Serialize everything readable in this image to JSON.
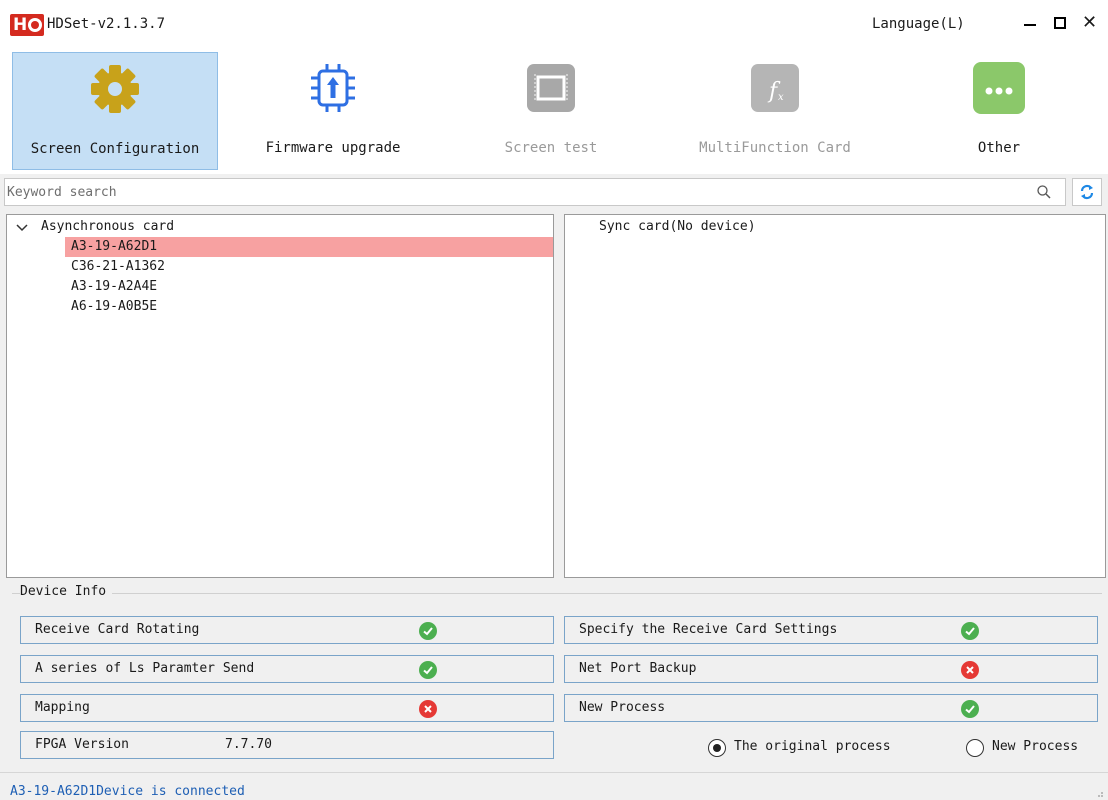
{
  "window": {
    "title": "HDSet-v2.1.3.7",
    "language_menu": "Language(L)"
  },
  "toolbar": {
    "items": [
      {
        "label": "Screen Configuration",
        "icon": "gear-icon",
        "color": "#c8a21a",
        "state": "active"
      },
      {
        "label": "Firmware upgrade",
        "icon": "chip-upgrade-icon",
        "color": "#2e6fe3",
        "state": "enabled"
      },
      {
        "label": "Screen test",
        "icon": "screen-test-icon",
        "color": "#a8a8a8",
        "state": "disabled"
      },
      {
        "label": "MultiFunction Card",
        "icon": "function-icon",
        "color": "#b5b5b5",
        "state": "disabled"
      },
      {
        "label": "Other",
        "icon": "more-icon",
        "color": "#8bc86a",
        "state": "enabled"
      }
    ]
  },
  "search": {
    "placeholder": "Keyword search",
    "value": ""
  },
  "async_panel": {
    "root_label": "Asynchronous card",
    "expanded": true,
    "devices": [
      "A3-19-A62D1",
      "C36-21-A1362",
      "A3-19-A2A4E",
      "A6-19-A0B5E"
    ],
    "selected_index": 0
  },
  "sync_panel": {
    "label": "Sync card(No device)"
  },
  "device_info": {
    "legend": "Device Info",
    "left": [
      {
        "label": "Receive Card Rotating",
        "status": "ok"
      },
      {
        "label": "A series of Ls Paramter Send",
        "status": "ok"
      },
      {
        "label": "Mapping",
        "status": "error"
      },
      {
        "label": "FPGA Version",
        "value": "7.7.70"
      }
    ],
    "right": [
      {
        "label": "Specify the Receive Card Settings",
        "status": "ok"
      },
      {
        "label": "Net Port Backup",
        "status": "error"
      },
      {
        "label": "New Process",
        "status": "ok"
      }
    ],
    "process_options": [
      {
        "label": "The original process",
        "checked": true
      },
      {
        "label": "New Process",
        "checked": false
      }
    ]
  },
  "statusbar": {
    "text": "A3-19-A62D1Device is connected"
  }
}
